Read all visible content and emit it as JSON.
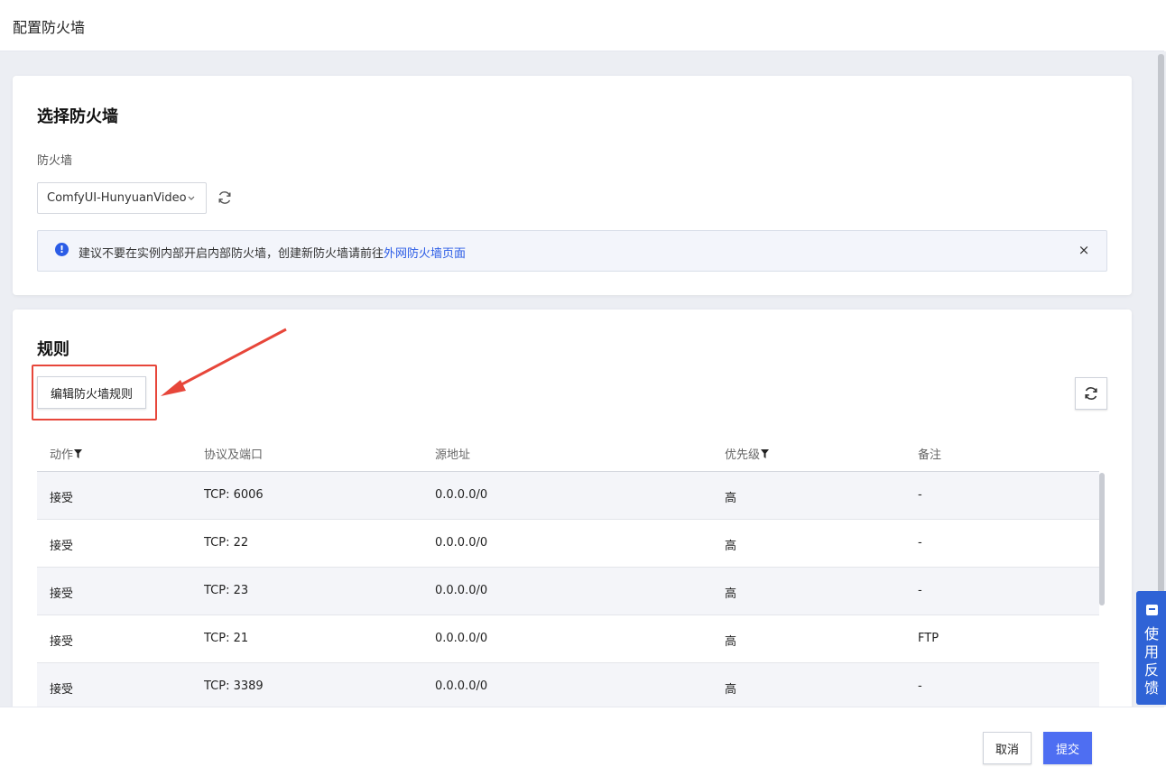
{
  "header": {
    "title": "配置防火墙"
  },
  "firewall_section": {
    "title": "选择防火墙",
    "field_label": "防火墙",
    "selected_value": "ComfyUI-HunyuanVideo",
    "alert": {
      "text": "建议不要在实例内部开启内部防火墙，创建新防火墙请前往",
      "link_text": "外网防火墙页面",
      "close": "×"
    }
  },
  "rules_section": {
    "title": "规则",
    "edit_button": "编辑防火墙规则",
    "columns": [
      "动作",
      "协议及端口",
      "源地址",
      "优先级",
      "备注"
    ],
    "rows": [
      [
        "接受",
        "TCP: 6006",
        "0.0.0.0/0",
        "高",
        "-"
      ],
      [
        "接受",
        "TCP: 22",
        "0.0.0.0/0",
        "高",
        "-"
      ],
      [
        "接受",
        "TCP: 23",
        "0.0.0.0/0",
        "高",
        "-"
      ],
      [
        "接受",
        "TCP: 21",
        "0.0.0.0/0",
        "高",
        "FTP"
      ],
      [
        "接受",
        "TCP: 3389",
        "0.0.0.0/0",
        "高",
        "-"
      ]
    ]
  },
  "footer": {
    "cancel": "取消",
    "submit": "提交"
  },
  "feedback": {
    "label": "使用反馈"
  },
  "colors": {
    "accent": "#4e6ef2",
    "link": "#2b5ce6",
    "highlight": "#e7463a"
  }
}
